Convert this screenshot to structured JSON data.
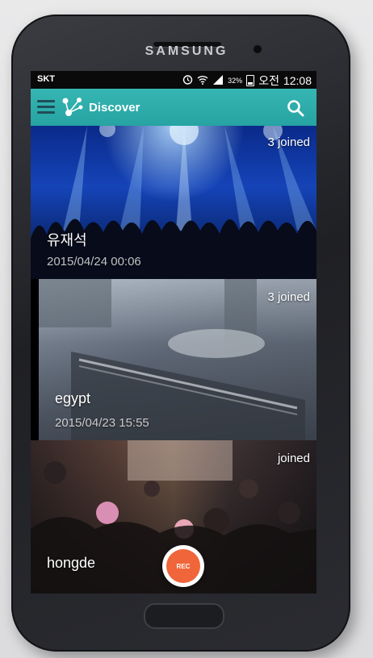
{
  "device": {
    "brand": "SAMSUNG"
  },
  "status_bar": {
    "carrier": "SKT",
    "battery": "32%",
    "ampm": "오전",
    "time": "12:08"
  },
  "app_bar": {
    "title": "Discover"
  },
  "feed": [
    {
      "title": "유재석",
      "date": "2015/04/24 00:06",
      "joined": "3 joined"
    },
    {
      "title": "egypt",
      "date": "2015/04/23 15:55",
      "joined": "3 joined"
    },
    {
      "title": "hongde",
      "date": "",
      "joined": "joined"
    }
  ],
  "rec_button": {
    "label": "REC"
  },
  "colors": {
    "accent": "#2aa9a8",
    "rec": "#f0653a"
  }
}
